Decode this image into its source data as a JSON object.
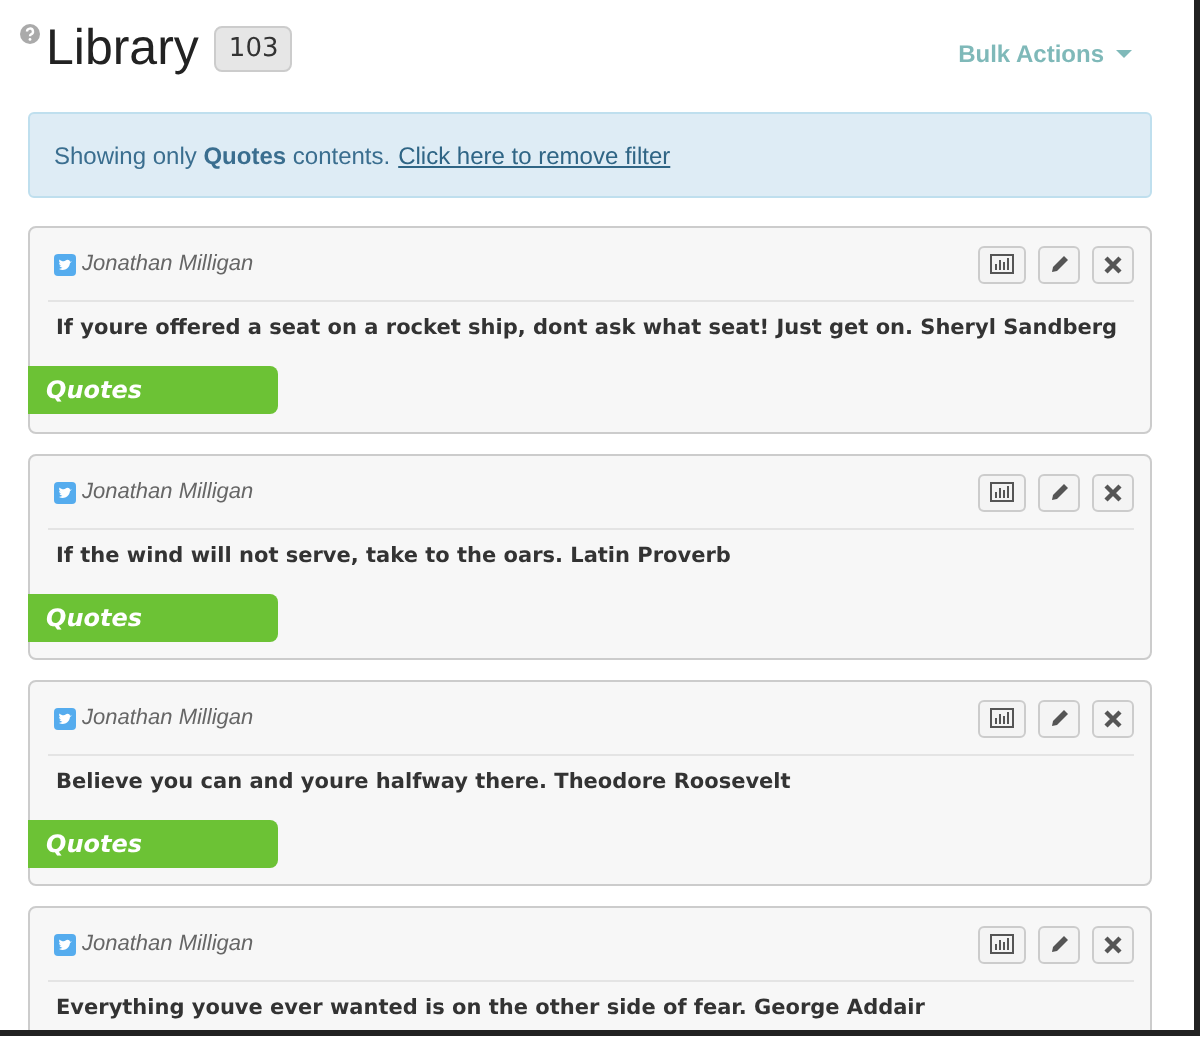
{
  "header": {
    "title": "Library",
    "count": "103",
    "bulk_actions": "Bulk Actions"
  },
  "filter_alert": {
    "text": "Showing only **Quotes** contents.",
    "link": "Click here to remove filter"
  },
  "posts": [
    {
      "author": "Jonathan Milligan",
      "text": "If youre offered a seat on a rocket ship, dont ask what seat! Just get on. Sheryl Sandberg",
      "tag": "Quotes"
    },
    {
      "author": "Jonathan Milligan",
      "text": "If the wind will not serve, take to the oars. Latin Proverb",
      "tag": "Quotes"
    },
    {
      "author": "Jonathan Milligan",
      "text": "Believe you can and youre halfway there. Theodore Roosevelt",
      "tag": "Quotes"
    },
    {
      "author": "Jonathan Milligan",
      "text": "Everything youve ever wanted is on the other side of fear. George Addair"
    }
  ]
}
